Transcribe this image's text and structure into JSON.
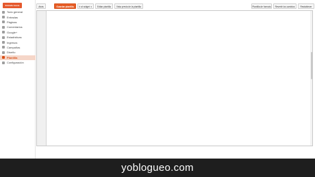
{
  "sidebar": {
    "new_entry": "Entrada nueva",
    "items": [
      {
        "label": "Todo general",
        "icon": "home-icon",
        "active": false
      },
      {
        "label": "Entradas",
        "icon": "posts-icon",
        "active": false
      },
      {
        "label": "Páginas",
        "icon": "pages-icon",
        "active": false
      },
      {
        "label": "Comentarios",
        "icon": "comments-icon",
        "active": false
      },
      {
        "label": "Google+",
        "icon": "google-plus-icon",
        "active": false
      },
      {
        "label": "Estadísticas",
        "icon": "stats-icon",
        "active": false
      },
      {
        "label": "Ingresos",
        "icon": "earnings-icon",
        "active": false
      },
      {
        "label": "Campañas",
        "icon": "campaigns-icon",
        "active": false
      },
      {
        "label": "Diseño",
        "icon": "layout-icon",
        "active": false
      },
      {
        "label": "Plantilla",
        "icon": "template-icon",
        "active": true
      },
      {
        "label": "Configuración",
        "icon": "settings-icon",
        "active": false
      }
    ]
  },
  "toolbar": {
    "back": "Atrás",
    "save": "Guardar plantilla",
    "jump": "Ir al widget",
    "edit_template": "Editar plantilla",
    "preview": "Vista previa de la plantilla",
    "format": "Plantilla de formato",
    "revert": "Revertir los cambios",
    "restore": "Restablecer"
  },
  "footer": {
    "brand": "yoblogueo.com"
  }
}
